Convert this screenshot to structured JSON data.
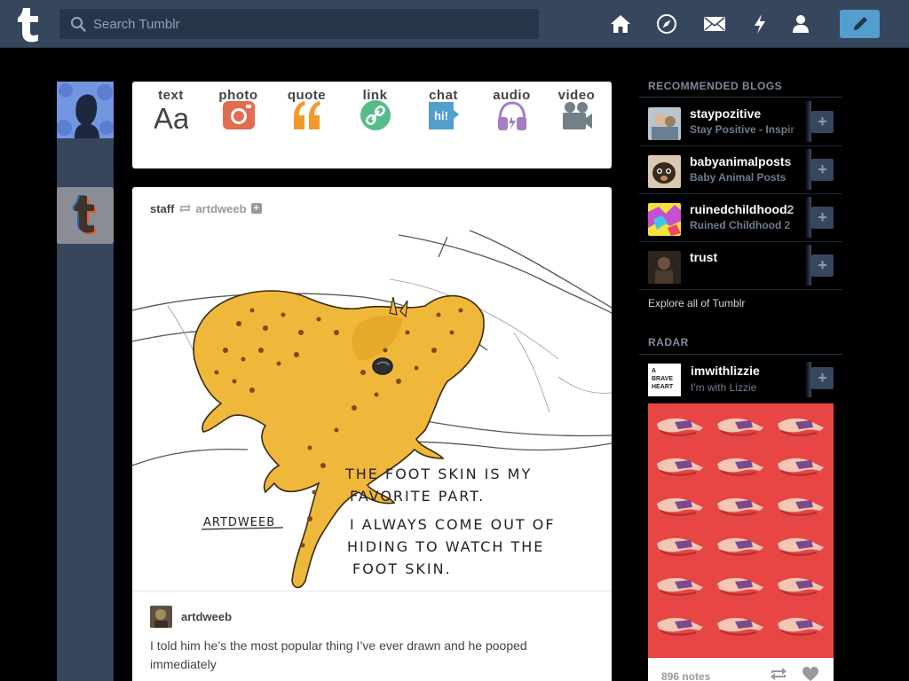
{
  "header": {
    "search_placeholder": "Search Tumblr",
    "nav_icons": [
      "home-icon",
      "explore-icon",
      "inbox-icon",
      "activity-icon",
      "account-icon"
    ],
    "compose_icon": "pencil-icon",
    "brand_color": "#36465d",
    "accent_color": "#529ecc"
  },
  "post_types": [
    {
      "label": "text",
      "icon": "text-aa-icon",
      "color": "#444444"
    },
    {
      "label": "photo",
      "icon": "camera-icon",
      "color": "#e06d50"
    },
    {
      "label": "quote",
      "icon": "quote-icon",
      "color": "#f2992e"
    },
    {
      "label": "link",
      "icon": "link-icon",
      "color": "#56bc8a"
    },
    {
      "label": "chat",
      "icon": "chat-bubble-icon",
      "color": "#529ecc"
    },
    {
      "label": "audio",
      "icon": "headphones-icon",
      "color": "#a77dc2"
    },
    {
      "label": "video",
      "icon": "video-camera-icon",
      "color": "#748089"
    }
  ],
  "post": {
    "author": "staff",
    "source": "artdweeb",
    "follow_symbol": "+",
    "drawing_text": [
      "THE FOOT SKIN IS MY",
      "FAVORITE PART.",
      "I ALWAYS COME OUT OF",
      "HIDING TO WATCH THE",
      "FOOT SKIN."
    ],
    "signature": "ARTDWEEB",
    "caption_author": "artdweeb",
    "caption": "I told him he’s the most popular thing I’ve ever drawn and he pooped immediately"
  },
  "sidebar": {
    "recommended_title": "RECOMMENDED BLOGS",
    "blogs": [
      {
        "name": "staypozitive",
        "title": "Stay Positive - Inspir",
        "avatar_color": "#a9b8c4"
      },
      {
        "name": "babyanimalposts",
        "title": "Baby Animal Posts",
        "avatar_color": "#caa06a"
      },
      {
        "name": "ruinedchildhood2",
        "title": "Ruined Childhood 2",
        "avatar_color": "#c84fd1"
      },
      {
        "name": "trust",
        "title": "",
        "avatar_color": "#4a3b30"
      }
    ],
    "follow_symbol": "+",
    "explore_label": "Explore all of Tumblr",
    "radar_title": "RADAR",
    "radar": {
      "name": "imwithlizzie",
      "title": "I'm with Lizzie",
      "avatar_lines": [
        "A",
        "BRAVE",
        "HEART"
      ],
      "notes": "896 notes",
      "image_color": "#e84545"
    }
  }
}
